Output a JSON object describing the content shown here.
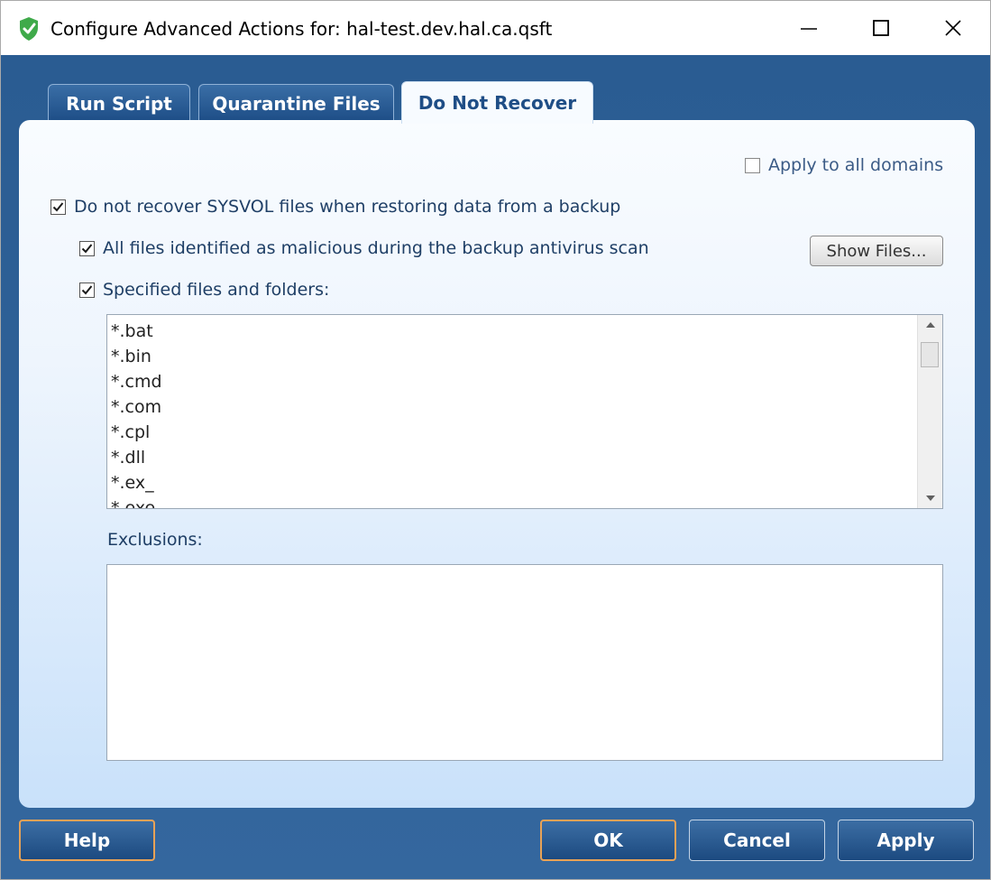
{
  "window": {
    "title": "Configure Advanced Actions for: hal-test.dev.hal.ca.qsft",
    "icon": "shield-check-icon",
    "accent_color": "#2f5f95"
  },
  "tabs": [
    {
      "label": "Run Script",
      "active": false
    },
    {
      "label": "Quarantine Files",
      "active": false
    },
    {
      "label": "Do Not Recover",
      "active": true
    }
  ],
  "options": {
    "apply_all_domains": {
      "label": "Apply to all domains",
      "checked": false
    },
    "do_not_recover_sysvol": {
      "label": "Do not recover SYSVOL files when restoring data from a backup",
      "checked": true
    },
    "malicious_files": {
      "label": "All files identified as malicious during the backup antivirus scan",
      "checked": true
    },
    "specified_files": {
      "label": "Specified files and folders:",
      "checked": true
    }
  },
  "show_files_label": "Show Files...",
  "file_list": [
    "*.bat",
    "*.bin",
    "*.cmd",
    "*.com",
    "*.cpl",
    "*.dll",
    "*.ex_",
    "*.exe"
  ],
  "exclusions": {
    "label": "Exclusions:",
    "value": ""
  },
  "footer": {
    "help": "Help",
    "ok": "OK",
    "cancel": "Cancel",
    "apply": "Apply"
  }
}
